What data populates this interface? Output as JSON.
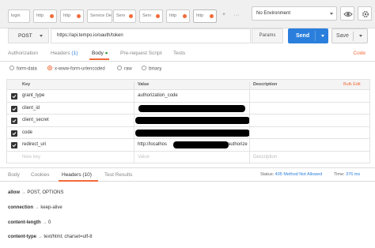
{
  "tabs": [
    {
      "label": "login",
      "dot": false
    },
    {
      "label": "http",
      "dot": true
    },
    {
      "label": "http",
      "dot": true
    },
    {
      "label": "Service De",
      "dot": false
    },
    {
      "label": "Serv",
      "dot": true
    },
    {
      "label": "Serv",
      "dot": true
    },
    {
      "label": "http",
      "dot": true
    },
    {
      "label": "http",
      "dot": true
    }
  ],
  "tab_add_label": "+",
  "tab_more_label": "···",
  "environment": {
    "selected": "No Environment"
  },
  "request": {
    "method": "POST",
    "url": "https://api.tempo.io/oauth/token",
    "params_label": "Params",
    "send_label": "Send",
    "save_label": "Save"
  },
  "request_tabs": {
    "authorization": "Authorization",
    "headers": "Headers",
    "headers_count": "(1)",
    "body": "Body",
    "prerequest": "Pre-request Script",
    "tests": "Tests",
    "code": "Code"
  },
  "body_types": {
    "form_data": "form-data",
    "urlencoded": "x-www-form-urlencoded",
    "raw": "raw",
    "binary": "binary"
  },
  "table": {
    "col_key": "Key",
    "col_value": "Value",
    "col_description": "Description",
    "bulk_edit": "Bulk Edit",
    "rows": [
      {
        "key": "grant_type",
        "value": "authorization_code"
      },
      {
        "key": "client_id",
        "value": ""
      },
      {
        "key": "client_secret",
        "value": ""
      },
      {
        "key": "code",
        "value": ""
      },
      {
        "key": "redirect_uri",
        "value_prefix": "http://localhos",
        "value_suffix": "authorize"
      }
    ],
    "new_key_placeholder": "New key",
    "value_placeholder": "Value",
    "description_placeholder": "Description"
  },
  "response_tabs": {
    "body": "Body",
    "cookies": "Cookies",
    "headers": "Headers",
    "headers_count": "(10)",
    "tests": "Test Results"
  },
  "response_status": {
    "status_label": "Status:",
    "status_value": "405 Method Not Allowed",
    "time_label": "Time:",
    "time_value": "376 ms"
  },
  "response_headers": [
    {
      "name": "allow",
      "value": "POST, OPTIONS"
    },
    {
      "name": "connection",
      "value": "keep-alive"
    },
    {
      "name": "content-length",
      "value": "0"
    },
    {
      "name": "content-type",
      "value": "text/html; charset=utf-8"
    }
  ],
  "colors": {
    "accent": "#f26b3a",
    "primary": "#2b7fdc"
  }
}
